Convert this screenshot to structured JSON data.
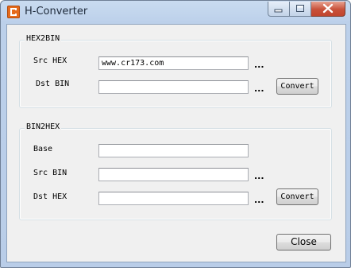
{
  "window": {
    "title": "H-Converter"
  },
  "hex2bin": {
    "legend": "HEX2BIN",
    "src_label": "Src HEX",
    "src_value": "www.cr173.com",
    "dst_label": "Dst BIN",
    "dst_value": "",
    "browse_label": "...",
    "convert_label": "Convert"
  },
  "bin2hex": {
    "legend": "BIN2HEX",
    "base_label": "Base",
    "base_value": "",
    "src_label": "Src BIN",
    "src_value": "",
    "dst_label": "Dst HEX",
    "dst_value": "",
    "browse_label": "...",
    "convert_label": "Convert"
  },
  "footer": {
    "close_label": "Close"
  },
  "colors": {
    "app_icon": "#e56a1b",
    "close_caption": "#c8513a",
    "frame": "#bcd0ea"
  }
}
